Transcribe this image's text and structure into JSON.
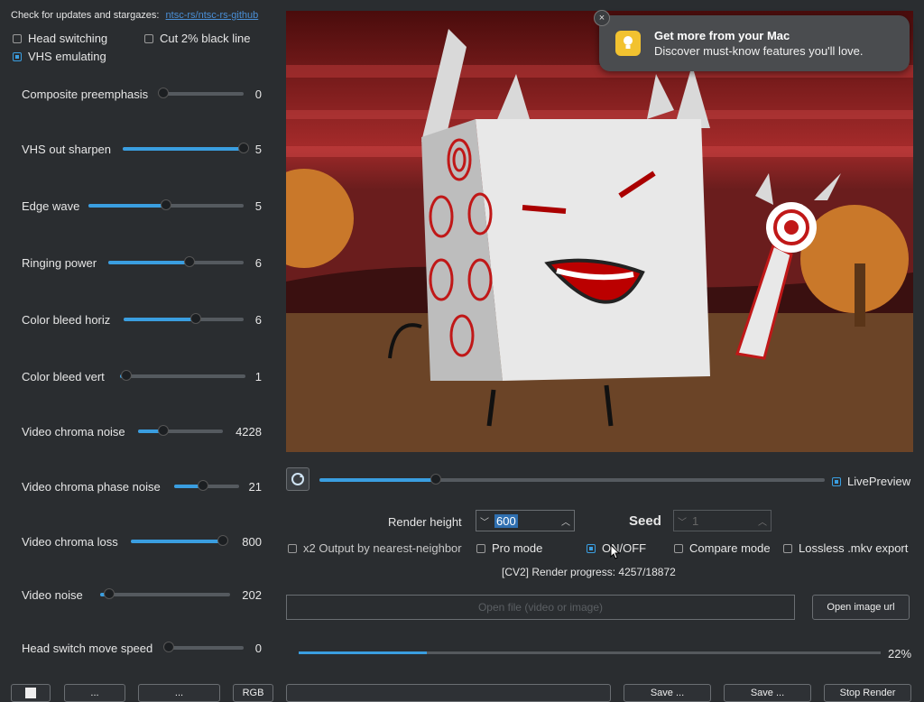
{
  "update": {
    "text": "Check for updates and stargazes:",
    "link": "ntsc-rs/ntsc-rs-github"
  },
  "options_top": [
    {
      "label": "Head switching",
      "checked": false
    },
    {
      "label": "Cut 2% black line",
      "checked": false
    },
    {
      "label": "VHS emulating",
      "checked": true
    }
  ],
  "sliders": [
    {
      "label": "Composite preemphasis",
      "value": "0",
      "fill": 0.0
    },
    {
      "label": "VHS out sharpen",
      "value": "5",
      "fill": 1.0
    },
    {
      "label": "Edge wave",
      "value": "5",
      "fill": 0.5
    },
    {
      "label": "Ringing power",
      "value": "6",
      "fill": 0.6
    },
    {
      "label": "Color bleed horiz",
      "value": "6",
      "fill": 0.6
    },
    {
      "label": "Color bleed vert",
      "value": "1",
      "fill": 0.05
    },
    {
      "label": "Video chroma noise",
      "value": "4228",
      "fill": 0.3
    },
    {
      "label": "Video chroma phase noise",
      "value": "21",
      "fill": 0.44
    },
    {
      "label": "Video chroma loss",
      "value": "800",
      "fill": 1.0
    },
    {
      "label": "Video noise",
      "value": "202",
      "fill": 0.07
    },
    {
      "label": "Head switch move speed",
      "value": "0",
      "fill": 0.0
    }
  ],
  "notification": {
    "title": "Get more from your Mac",
    "body": "Discover must-know features you'll love.",
    "close": "×"
  },
  "timeline": {
    "position": 0.23
  },
  "live_preview": {
    "label": "LivePreview",
    "checked": true
  },
  "render_height": {
    "label": "Render height",
    "value": "600"
  },
  "seed": {
    "label": "Seed",
    "value": "1"
  },
  "options_row": [
    {
      "label": "x2 Output by nearest-neighbor",
      "checked": false
    },
    {
      "label": "Pro mode",
      "checked": false
    },
    {
      "label": "ON/OFF",
      "checked": true
    },
    {
      "label": "Compare mode",
      "checked": false
    },
    {
      "label": "Lossless .mkv export",
      "checked": false
    }
  ],
  "render_progress": "[CV2] Render progress: 4257/18872",
  "open_file_placeholder": "Open file (video or image)",
  "open_image_url": "Open image url",
  "progress": {
    "percent_label": "22%",
    "fraction": 0.22
  },
  "bottom_buttons": [
    "",
    "...",
    "...",
    "RGB",
    "Save ...",
    "Save ...",
    "Stop Render"
  ],
  "colors": {
    "accent": "#3a9ee0",
    "bg": "#2a2d30"
  }
}
